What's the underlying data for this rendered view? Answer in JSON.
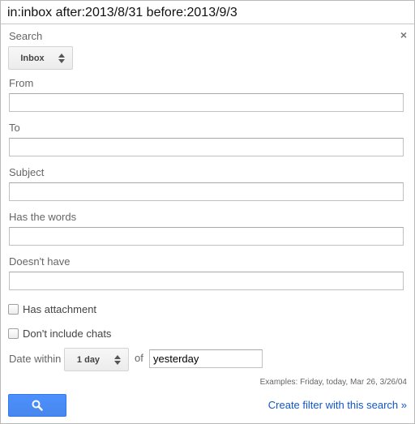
{
  "query": "in:inbox after:2013/8/31 before:2013/9/3",
  "close_glyph": "×",
  "search": {
    "label": "Search",
    "scope_value": "Inbox"
  },
  "fields": {
    "from_label": "From",
    "to_label": "To",
    "subject_label": "Subject",
    "has_words_label": "Has the words",
    "doesnt_have_label": "Doesn't have"
  },
  "options": {
    "has_attachment": "Has attachment",
    "no_chats": "Don't include chats"
  },
  "date": {
    "label": "Date within",
    "range_value": "1 day",
    "of_label": "of",
    "date_value": "yesterday",
    "examples": "Examples: Friday, today, Mar 26, 3/26/04"
  },
  "actions": {
    "create_filter": "Create filter with this search »"
  },
  "colors": {
    "accent": "#4d90fe",
    "link": "#1155cc"
  }
}
